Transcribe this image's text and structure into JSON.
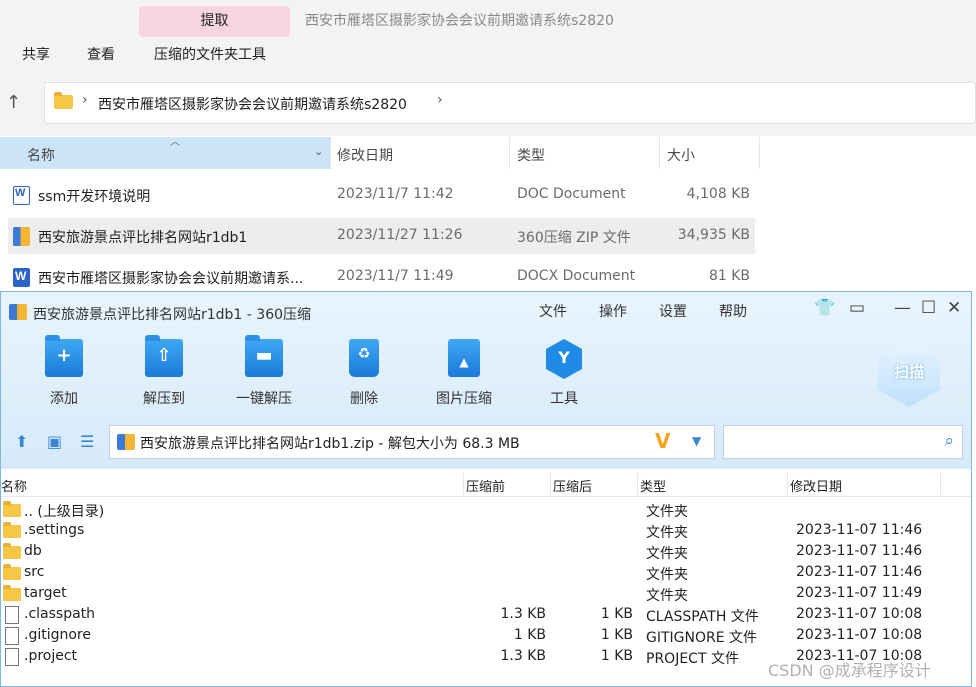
{
  "explorer": {
    "extract_tab": "提取",
    "window_title": "西安市雁塔区摄影家协会会议前期邀请系统s2820",
    "ribbon_tabs": [
      "共享",
      "查看",
      "压缩的文件夹工具"
    ],
    "breadcrumb": "西安市雁塔区摄影家协会会议前期邀请系统s2820",
    "columns": {
      "name": "名称",
      "date": "修改日期",
      "type": "类型",
      "size": "大小"
    },
    "files": [
      {
        "name": "ssm开发环境说明",
        "date": "2023/11/7 11:42",
        "type": "DOC Document",
        "size": "4,108 KB",
        "icon": "word-doc-icon"
      },
      {
        "name": "西安旅游景点评比排名网站r1db1",
        "date": "2023/11/27 11:26",
        "type": "360压缩 ZIP 文件",
        "size": "34,935 KB",
        "icon": "zip-archive-icon"
      },
      {
        "name": "西安市雁塔区摄影家协会会议前期邀请系...",
        "date": "2023/11/7 11:49",
        "type": "DOCX Document",
        "size": "81 KB",
        "icon": "word-docx-icon"
      }
    ]
  },
  "zip": {
    "title": "西安旅游景点评比排名网站r1db1 - 360压缩",
    "menu": [
      "文件",
      "操作",
      "设置",
      "帮助"
    ],
    "toolbar": [
      {
        "label": "添加",
        "icon": "add-icon"
      },
      {
        "label": "解压到",
        "icon": "extract-to-icon"
      },
      {
        "label": "一键解压",
        "icon": "one-click-extract-icon"
      },
      {
        "label": "删除",
        "icon": "delete-icon"
      },
      {
        "label": "图片压缩",
        "icon": "image-compress-icon"
      },
      {
        "label": "工具",
        "icon": "tools-icon"
      }
    ],
    "scan_label": "扫描",
    "path_text": "西安旅游景点评比排名网站r1db1.zip - 解包大小为 68.3 MB",
    "columns": {
      "name": "名称",
      "before": "压缩前",
      "after": "压缩后",
      "type": "类型",
      "date": "修改日期"
    },
    "rows": [
      {
        "name": ".. (上级目录)",
        "before": "",
        "after": "",
        "type": "文件夹",
        "date": "",
        "kind": "folder"
      },
      {
        "name": ".settings",
        "before": "",
        "after": "",
        "type": "文件夹",
        "date": "2023-11-07 11:46",
        "kind": "folder"
      },
      {
        "name": "db",
        "before": "",
        "after": "",
        "type": "文件夹",
        "date": "2023-11-07 11:46",
        "kind": "folder"
      },
      {
        "name": "src",
        "before": "",
        "after": "",
        "type": "文件夹",
        "date": "2023-11-07 11:46",
        "kind": "folder"
      },
      {
        "name": "target",
        "before": "",
        "after": "",
        "type": "文件夹",
        "date": "2023-11-07 11:49",
        "kind": "folder"
      },
      {
        "name": ".classpath",
        "before": "1.3 KB",
        "after": "1 KB",
        "type": "CLASSPATH 文件",
        "date": "2023-11-07 10:08",
        "kind": "file"
      },
      {
        "name": ".gitignore",
        "before": "1 KB",
        "after": "1 KB",
        "type": "GITIGNORE 文件",
        "date": "2023-11-07 10:08",
        "kind": "file"
      },
      {
        "name": ".project",
        "before": "1.3 KB",
        "after": "1 KB",
        "type": "PROJECT 文件",
        "date": "2023-11-07 10:08",
        "kind": "file"
      }
    ]
  },
  "watermark": "CSDN @成承程序设计"
}
